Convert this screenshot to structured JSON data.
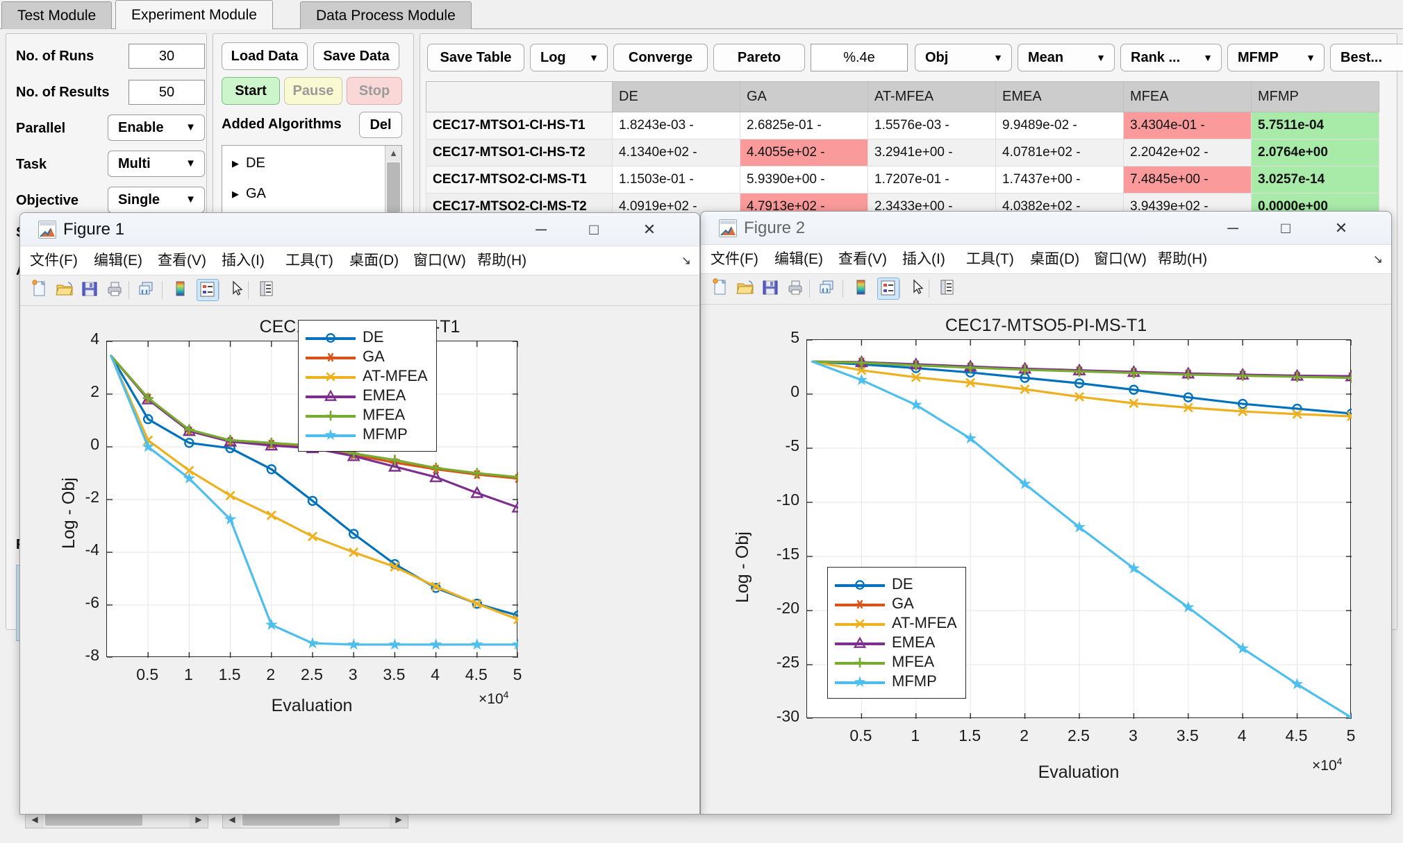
{
  "app": {
    "tabs": [
      {
        "label": "Test Module",
        "active": false
      },
      {
        "label": "Experiment Module",
        "active": true
      },
      {
        "label": "Data Process Module",
        "active": false
      }
    ]
  },
  "params": {
    "runs_label": "No. of Runs",
    "runs_value": "30",
    "results_label": "No. of Results",
    "results_value": "50",
    "parallel_label": "Parallel",
    "parallel_value": "Enable",
    "task_label": "Task",
    "task_value": "Multi",
    "objective_label": "Objective",
    "objective_value": "Single",
    "special_label": "S",
    "problems_label": "A",
    "fig_label": "F"
  },
  "algorithms": {
    "load_data": "Load Data",
    "save_data": "Save Data",
    "start": "Start",
    "pause": "Pause",
    "stop": "Stop",
    "added_label": "Added Algorithms",
    "del": "Del",
    "items": [
      "DE",
      "GA"
    ]
  },
  "toolbar": {
    "save_table": "Save Table",
    "log": "Log",
    "converge": "Converge",
    "pareto": "Pareto",
    "format": "%.4e",
    "obj": "Obj",
    "mean": "Mean",
    "rank": "Rank ...",
    "mfmp": "MFMP",
    "best": "Best..."
  },
  "table": {
    "columns": [
      "",
      "DE",
      "GA",
      "AT-MFEA",
      "EMEA",
      "MFEA",
      "MFMP"
    ],
    "rows": [
      {
        "name": "CEC17-MTSO1-CI-HS-T1",
        "cells": [
          {
            "v": "1.8243e-03 -",
            "s": ""
          },
          {
            "v": "2.6825e-01 -",
            "s": ""
          },
          {
            "v": "1.5576e-03 -",
            "s": ""
          },
          {
            "v": "9.9489e-02 -",
            "s": ""
          },
          {
            "v": "3.4304e-01 -",
            "s": "bad"
          },
          {
            "v": "5.7511e-04",
            "s": "best"
          }
        ]
      },
      {
        "name": "CEC17-MTSO1-CI-HS-T2",
        "cells": [
          {
            "v": "4.1340e+02 -",
            "s": ""
          },
          {
            "v": "4.4055e+02 -",
            "s": "bad"
          },
          {
            "v": "3.2941e+00 -",
            "s": ""
          },
          {
            "v": "4.0781e+02 -",
            "s": ""
          },
          {
            "v": "2.2042e+02 -",
            "s": ""
          },
          {
            "v": "2.0764e+00",
            "s": "best"
          }
        ]
      },
      {
        "name": "CEC17-MTSO2-CI-MS-T1",
        "cells": [
          {
            "v": "1.1503e-01 -",
            "s": ""
          },
          {
            "v": "5.9390e+00 -",
            "s": ""
          },
          {
            "v": "1.7207e-01 -",
            "s": ""
          },
          {
            "v": "1.7437e+00 -",
            "s": ""
          },
          {
            "v": "7.4845e+00 -",
            "s": "bad"
          },
          {
            "v": "3.0257e-14",
            "s": "best"
          }
        ]
      },
      {
        "name": "CEC17-MTSO2-CI-MS-T2",
        "cells": [
          {
            "v": "4.0919e+02 -",
            "s": ""
          },
          {
            "v": "4.7913e+02 -",
            "s": "bad"
          },
          {
            "v": "2.3433e+00 -",
            "s": ""
          },
          {
            "v": "4.0382e+02 -",
            "s": ""
          },
          {
            "v": "3.9439e+02 -",
            "s": ""
          },
          {
            "v": "0.0000e+00",
            "s": "best"
          }
        ]
      }
    ]
  },
  "figure1": {
    "window_title": "Figure 1",
    "menu": [
      "文件(F)",
      "编辑(E)",
      "查看(V)",
      "插入(I)",
      "工具(T)",
      "桌面(D)",
      "窗口(W)",
      "帮助(H)"
    ],
    "icons": [
      "new-figure-icon",
      "open-folder-icon",
      "save-icon",
      "print-icon",
      "link-plot-icon",
      "colorbar-icon",
      "legend-icon",
      "pointer-icon",
      "property-inspector-icon"
    ],
    "window_buttons": [
      "minimize",
      "maximize",
      "close"
    ]
  },
  "figure2": {
    "window_title": "Figure 2",
    "menu": [
      "文件(F)",
      "编辑(E)",
      "查看(V)",
      "插入(I)",
      "工具(T)",
      "桌面(D)",
      "窗口(W)",
      "帮助(H)"
    ],
    "icons": [
      "new-figure-icon",
      "open-folder-icon",
      "save-icon",
      "print-icon",
      "link-plot-icon",
      "colorbar-icon",
      "legend-icon",
      "pointer-icon",
      "property-inspector-icon"
    ],
    "window_buttons": [
      "minimize",
      "maximize",
      "close"
    ]
  },
  "chart_data": [
    {
      "id": "fig1",
      "type": "line",
      "title": "CEC17-MTSO1-CI-HS-T1",
      "xlabel": "Evaluation",
      "ylabel": "Log - Obj",
      "x_exponent": "×10",
      "x_exponent_sup": "4",
      "xlim": [
        0,
        5
      ],
      "ylim": [
        -8,
        4
      ],
      "xticks": [
        "0.5",
        "1",
        "1.5",
        "2",
        "2.5",
        "3",
        "3.5",
        "4",
        "4.5",
        "5"
      ],
      "xtick_values": [
        0.5,
        1,
        1.5,
        2,
        2.5,
        3,
        3.5,
        4,
        4.5,
        5
      ],
      "yticks": [
        "4",
        "2",
        "0",
        "-2",
        "-4",
        "-6",
        "-8"
      ],
      "ytick_values": [
        4,
        2,
        0,
        -2,
        -4,
        -6,
        -8
      ],
      "grid": true,
      "legend_position": "top-right",
      "x": [
        0.05,
        0.5,
        1.0,
        1.5,
        2.0,
        2.5,
        3.0,
        3.5,
        4.0,
        4.5,
        5.0
      ],
      "series": [
        {
          "name": "DE",
          "color": "#0072BD",
          "marker": "circle",
          "values": [
            3.45,
            1.05,
            0.15,
            -0.05,
            -0.85,
            -2.05,
            -3.3,
            -4.45,
            -5.35,
            -5.95,
            -6.4
          ]
        },
        {
          "name": "GA",
          "color": "#D95319",
          "marker": "asterisk",
          "values": [
            3.45,
            1.85,
            0.6,
            0.2,
            0.1,
            0.0,
            -0.3,
            -0.6,
            -0.85,
            -1.05,
            -1.2
          ]
        },
        {
          "name": "AT-MFEA",
          "color": "#EDB120",
          "marker": "cross",
          "values": [
            3.45,
            0.25,
            -0.9,
            -1.85,
            -2.6,
            -3.4,
            -4.0,
            -4.55,
            -5.3,
            -5.95,
            -6.55
          ]
        },
        {
          "name": "EMEA",
          "color": "#7E2F8E",
          "marker": "triangle",
          "values": [
            3.45,
            1.8,
            0.6,
            0.2,
            0.05,
            -0.05,
            -0.35,
            -0.75,
            -1.15,
            -1.75,
            -2.3
          ]
        },
        {
          "name": "MFEA",
          "color": "#77AC30",
          "marker": "plus",
          "values": [
            3.45,
            1.85,
            0.65,
            0.25,
            0.15,
            0.05,
            -0.25,
            -0.5,
            -0.8,
            -1.0,
            -1.15
          ]
        },
        {
          "name": "MFMP",
          "color": "#4DBEEE",
          "marker": "star",
          "values": [
            3.45,
            0.0,
            -1.2,
            -2.75,
            -6.75,
            -7.45,
            -7.5,
            -7.5,
            -7.5,
            -7.5,
            -7.5
          ]
        }
      ]
    },
    {
      "id": "fig2",
      "type": "line",
      "title": "CEC17-MTSO5-PI-MS-T1",
      "xlabel": "Evaluation",
      "ylabel": "Log - Obj",
      "x_exponent": "×10",
      "x_exponent_sup": "4",
      "xlim": [
        0,
        5
      ],
      "ylim": [
        -30,
        5
      ],
      "xticks": [
        "0.5",
        "1",
        "1.5",
        "2",
        "2.5",
        "3",
        "3.5",
        "4",
        "4.5",
        "5"
      ],
      "xtick_values": [
        0.5,
        1,
        1.5,
        2,
        2.5,
        3,
        3.5,
        4,
        4.5,
        5
      ],
      "yticks": [
        "5",
        "0",
        "-5",
        "-10",
        "-15",
        "-20",
        "-25",
        "-30"
      ],
      "ytick_values": [
        5,
        0,
        -5,
        -10,
        -15,
        -20,
        -25,
        -30
      ],
      "grid": true,
      "legend_position": "bottom-left",
      "x": [
        0.05,
        0.5,
        1.0,
        1.5,
        2.0,
        2.5,
        3.0,
        3.5,
        4.0,
        4.5,
        5.0
      ],
      "series": [
        {
          "name": "DE",
          "color": "#0072BD",
          "marker": "circle",
          "values": [
            3.0,
            2.75,
            2.4,
            2.0,
            1.5,
            1.0,
            0.4,
            -0.3,
            -0.9,
            -1.35,
            -1.8
          ]
        },
        {
          "name": "GA",
          "color": "#D95319",
          "marker": "asterisk",
          "values": [
            3.0,
            2.95,
            2.7,
            2.5,
            2.3,
            2.15,
            2.0,
            1.85,
            1.75,
            1.65,
            1.6
          ]
        },
        {
          "name": "AT-MFEA",
          "color": "#EDB120",
          "marker": "cross",
          "values": [
            3.0,
            2.2,
            1.55,
            1.05,
            0.45,
            -0.25,
            -0.85,
            -1.25,
            -1.6,
            -1.85,
            -2.05
          ]
        },
        {
          "name": "EMEA",
          "color": "#7E2F8E",
          "marker": "triangle",
          "values": [
            3.0,
            2.95,
            2.75,
            2.55,
            2.35,
            2.2,
            2.05,
            1.9,
            1.8,
            1.7,
            1.65
          ]
        },
        {
          "name": "MFEA",
          "color": "#77AC30",
          "marker": "plus",
          "values": [
            3.0,
            2.9,
            2.65,
            2.45,
            2.25,
            2.1,
            1.95,
            1.8,
            1.7,
            1.6,
            1.5
          ]
        },
        {
          "name": "MFMP",
          "color": "#4DBEEE",
          "marker": "star",
          "values": [
            3.0,
            1.3,
            -1.0,
            -4.1,
            -8.3,
            -12.3,
            -16.1,
            -19.7,
            -23.5,
            -26.8,
            -29.9
          ]
        }
      ]
    }
  ]
}
